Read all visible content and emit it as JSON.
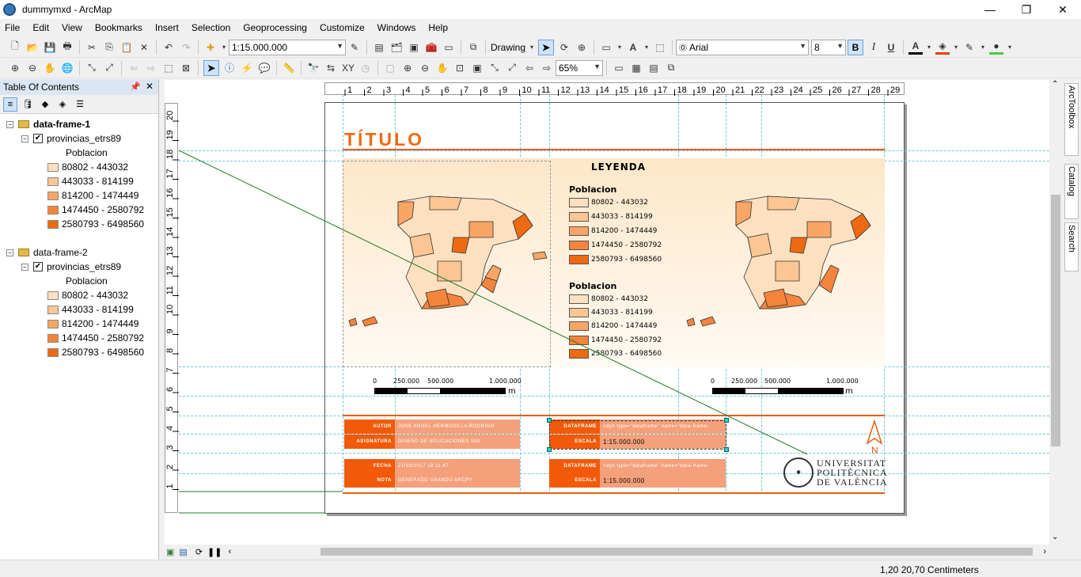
{
  "window": {
    "title": "dummymxd - ArcMap"
  },
  "menu": [
    "File",
    "Edit",
    "View",
    "Bookmarks",
    "Insert",
    "Selection",
    "Geoprocessing",
    "Customize",
    "Windows",
    "Help"
  ],
  "toolbar": {
    "scale_value": "1:15.000.000",
    "drawing_label": "Drawing",
    "font_name": "Arial",
    "font_size": "8",
    "bold": "B",
    "italic": "I",
    "underline": "U",
    "zoom_value": "65%"
  },
  "toc": {
    "header": "Table Of Contents",
    "frames": [
      {
        "name": "data-frame-1",
        "layer": "provincias_etrs89",
        "field": "Poblacion",
        "classes": [
          "80802 - 443032",
          "443033 - 814199",
          "814200 - 1474449",
          "1474450 - 2580792",
          "2580793 - 6498560"
        ]
      },
      {
        "name": "data-frame-2",
        "layer": "provincias_etrs89",
        "field": "Poblacion",
        "classes": [
          "80802 - 443032",
          "443033 - 814199",
          "814200 - 1474449",
          "1474450 - 2580792",
          "2580793 - 6498560"
        ]
      }
    ],
    "class_colors": [
      "#fde0bf",
      "#fbc693",
      "#f8a565",
      "#f5843b",
      "#ee6a12"
    ]
  },
  "layout": {
    "title": "TÍTULO",
    "legend_title": "LEYENDA",
    "legend_groups": [
      {
        "heading": "Poblacion",
        "items": [
          "80802 - 443032",
          "443033 - 814199",
          "814200 - 1474449",
          "1474450 - 2580792",
          "2580793 - 6498560"
        ]
      },
      {
        "heading": "Poblacion",
        "items": [
          "80802 - 443032",
          "443033 - 814199",
          "814200 - 1474449",
          "1474450 - 2580792",
          "2580793 - 6498560"
        ]
      }
    ],
    "scalebar_1": {
      "labels": [
        "0",
        "250.000",
        "500.000",
        "1.000.000"
      ],
      "unit": "m"
    },
    "scalebar_2": {
      "labels": [
        "0",
        "250.000",
        "500.000",
        "1.000.000"
      ],
      "unit": "m"
    },
    "info": {
      "autor_k": "AUTOR",
      "autor_v": "JOSE ANGEL HERMOSILLA RODRIGO",
      "asignatura_k": "ASIGNATURA",
      "asignatura_v": "DISEÑO DE APLICACIONES SIG",
      "fecha_k": "FECHA",
      "fecha_v": "21/03/2017 18:11:47",
      "nota_k": "NOTA",
      "nota_v": "GENERADO USANDO ARCPY",
      "df1_k": "DATAFRAME",
      "df1_v": "<dyn type=\"dataframe\" name=\"data-frame-",
      "escala1_k": "ESCALA",
      "escala1_v": "1:15.000.000",
      "df2_k": "DATAFRAME",
      "df2_v": "<dyn type=\"dataframe\" name=\"data-frame-",
      "escala2_k": "ESCALA",
      "escala2_v": "1:15.000.000"
    },
    "north_label": "N",
    "university": [
      "UNIVERSITAT",
      "POLITÈCNICA",
      "DE VALÈNCIA"
    ]
  },
  "hruler_labels": [
    "1",
    "2",
    "3",
    "4",
    "5",
    "6",
    "7",
    "8",
    "9",
    "10",
    "11",
    "12",
    "13",
    "14",
    "15",
    "16",
    "17",
    "18",
    "19",
    "20",
    "21",
    "22",
    "23",
    "24",
    "25",
    "26",
    "27",
    "28",
    "29"
  ],
  "vruler_labels": [
    "20",
    "19",
    "18",
    "17",
    "16",
    "15",
    "14",
    "13",
    "12",
    "11",
    "10",
    "9",
    "8",
    "7",
    "6",
    "5",
    "4",
    "3",
    "2",
    "1"
  ],
  "right_dock": [
    "ArcToolbox",
    "Catalog",
    "Search"
  ],
  "status": {
    "coords": "1,20  20,70 Centimeters"
  }
}
